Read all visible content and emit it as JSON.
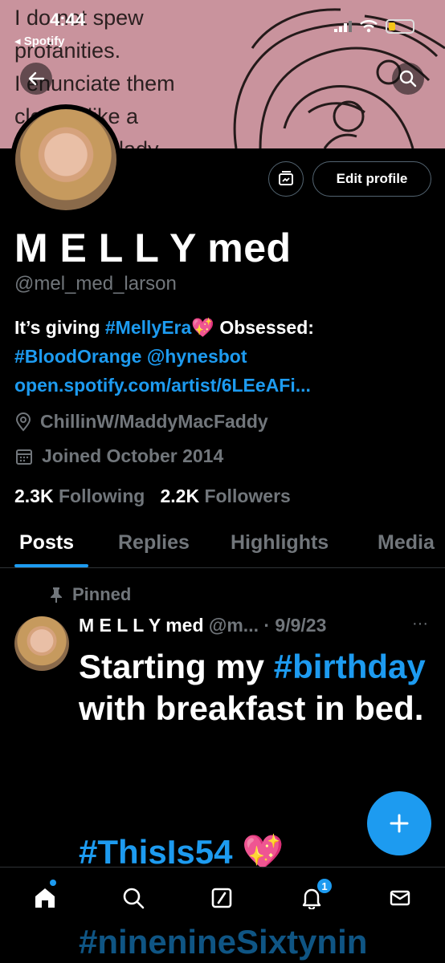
{
  "status_bar": {
    "time": "4:44",
    "back_app": "◂ Spotify"
  },
  "banner": {
    "lines": [
      "I do not spew",
      "profanities.",
      "I enunciate them",
      "clearly, like a",
      "lady."
    ]
  },
  "profile": {
    "edit_label": "Edit profile",
    "name": "M E L L Y med",
    "handle": "@mel_med_larson",
    "bio_prefix": "It’s giving ",
    "bio_tag1": "#MellyEra💖",
    "bio_mid": " Obsessed:",
    "bio_tag2": "#BloodOrange",
    "bio_mention": "@hynesbot",
    "bio_link": "open.spotify.com/artist/6LEeAFi...",
    "location": "ChillinW/MaddyMacFaddy",
    "joined": "Joined October 2014",
    "following_count": "2.3K",
    "following_label": "Following",
    "followers_count": "2.2K",
    "followers_label": "Followers"
  },
  "tabs": [
    {
      "label": "Posts"
    },
    {
      "label": "Replies"
    },
    {
      "label": "Highlights"
    },
    {
      "label": "Media"
    }
  ],
  "post": {
    "pinned_label": "Pinned",
    "author_name": "M E L L Y med",
    "author_handle": "@m...",
    "date": "· 9/9/23",
    "more": "···",
    "text_1": "Starting my ",
    "tag_1": "#birthday",
    "text_2": " with breakfast in bed.",
    "tag_2": "#ThisIs54 💖",
    "tag_3": "#ninenineSixtynin"
  },
  "nav": {
    "notification_count": "1"
  },
  "colors": {
    "accent": "#1d9bf0",
    "muted": "#71767b",
    "background": "#000000"
  },
  "icons": [
    "back-arrow-icon",
    "search-icon",
    "media-frame-icon",
    "location-pin-icon",
    "calendar-icon",
    "pin-icon",
    "plus-icon",
    "home-icon",
    "grok-icon",
    "bell-icon",
    "mail-icon"
  ]
}
